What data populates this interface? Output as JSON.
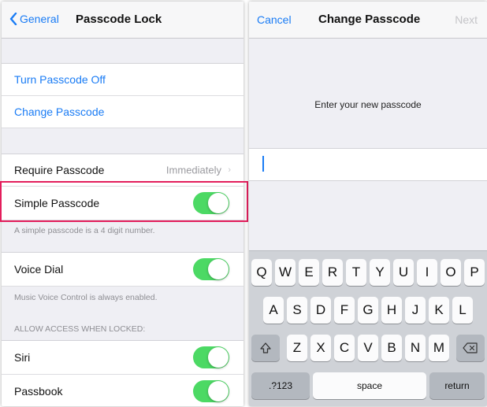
{
  "left_screen": {
    "nav": {
      "back_label": "General",
      "title": "Passcode Lock"
    },
    "group1": {
      "turn_off_label": "Turn Passcode Off",
      "change_label": "Change Passcode"
    },
    "require": {
      "label": "Require Passcode",
      "value": "Immediately"
    },
    "simple": {
      "label": "Simple Passcode",
      "on": true,
      "footnote": "A simple passcode is a 4 digit number."
    },
    "voice_dial": {
      "label": "Voice Dial",
      "on": true,
      "footnote": "Music Voice Control is always enabled."
    },
    "allow_header": "ALLOW ACCESS WHEN LOCKED:",
    "siri": {
      "label": "Siri",
      "on": true
    },
    "passbook": {
      "label": "Passbook",
      "on": true
    }
  },
  "right_screen": {
    "nav": {
      "cancel_label": "Cancel",
      "title": "Change Passcode",
      "next_label": "Next"
    },
    "prompt": "Enter your new passcode",
    "keyboard": {
      "row1": [
        "Q",
        "W",
        "E",
        "R",
        "T",
        "Y",
        "U",
        "I",
        "O",
        "P"
      ],
      "row2": [
        "A",
        "S",
        "D",
        "F",
        "G",
        "H",
        "J",
        "K",
        "L"
      ],
      "row3": [
        "Z",
        "X",
        "C",
        "V",
        "B",
        "N",
        "M"
      ],
      "numbers_label": ".?123",
      "space_label": "space",
      "return_label": "return"
    }
  },
  "colors": {
    "accent": "#1a7cf5",
    "toggle_on": "#4cd964",
    "highlight": "#e31e5c"
  }
}
